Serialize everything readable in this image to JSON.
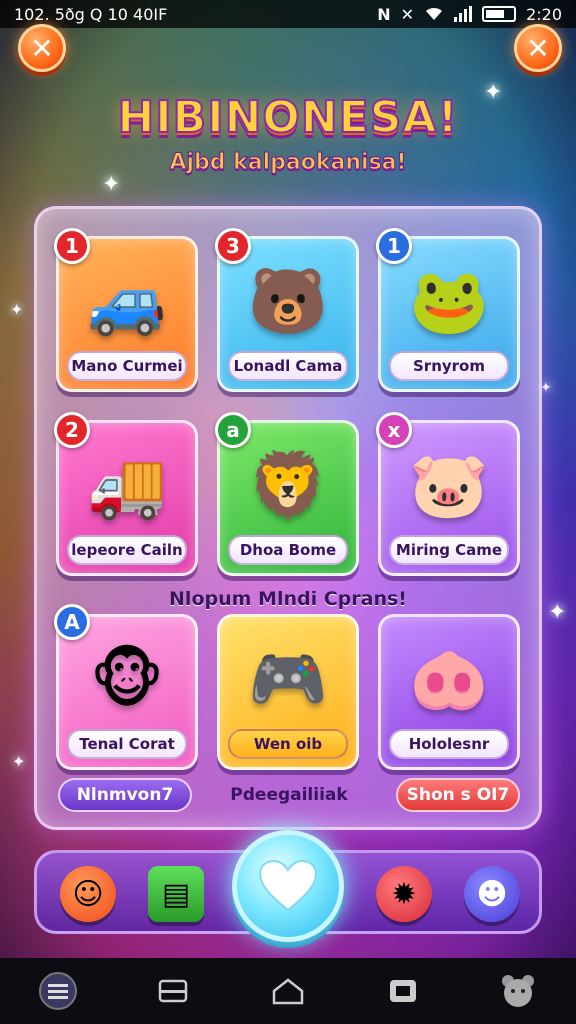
{
  "status_bar": {
    "left_text": "102. 5ðg Q 10 40IF",
    "time": "2:20",
    "icons": [
      "nfc-icon",
      "mute-icon",
      "wifi-icon",
      "signal-icon",
      "battery-icon"
    ]
  },
  "header": {
    "title": "HIBINONESA!",
    "subtitle": "Ajbd kalpaokanisa!",
    "left_button_icon": "close-icon",
    "right_button_icon": "close-icon"
  },
  "games": [
    {
      "label": "Mano Curmei",
      "badge": "1",
      "badge_color": "#e2262b",
      "card_color": "#ff9a3c",
      "icon": "toy-car"
    },
    {
      "label": "Lonadl Cama",
      "badge": "3",
      "badge_color": "#e2262b",
      "card_color": "#4fc7f2",
      "icon": "bears"
    },
    {
      "label": "Srnyrom",
      "badge": "1",
      "badge_color": "#2a6de0",
      "card_color": "#48b8f0",
      "icon": "green-bear"
    },
    {
      "label": "lepeore Cailn",
      "badge": "2",
      "badge_color": "#e2262b",
      "card_color": "#f255b8",
      "icon": "blue-truck"
    },
    {
      "label": "Dhoa Bome",
      "badge": "a",
      "badge_color": "#23a33a",
      "card_color": "#4ccf48",
      "icon": "lion"
    },
    {
      "label": "Miring Came",
      "badge": "x",
      "badge_color": "#d640b8",
      "card_color": "#b770f0",
      "icon": "pig-rocket"
    },
    {
      "label": "Tenal Corat",
      "badge": "A",
      "badge_color": "#2a6de0",
      "card_color": "#ff7bd0",
      "icon": "friends"
    },
    {
      "label": "Wen oib",
      "badge": "",
      "badge_color": "#ffb800",
      "card_color": "#ffc93a",
      "icon": "gadget"
    },
    {
      "label": "Hololesnr",
      "badge": "",
      "badge_color": "#c040f0",
      "card_color": "#b05cf0",
      "icon": "robot-pig"
    }
  ],
  "middle_caption": "Nlopum Mlndi Cprans!",
  "pills": {
    "left": "Nlnmvon7",
    "center": "Pdeegailiiak",
    "right": "Shon s OI7"
  },
  "dock": {
    "icons": [
      "smiley-icon",
      "backpack-icon",
      "heart-icon",
      "red-monster-icon",
      "blue-ghost-icon"
    ]
  },
  "nav": {
    "icons": [
      "menu-icon",
      "back-icon",
      "home-icon",
      "recent-icon",
      "mascot-icon"
    ]
  }
}
